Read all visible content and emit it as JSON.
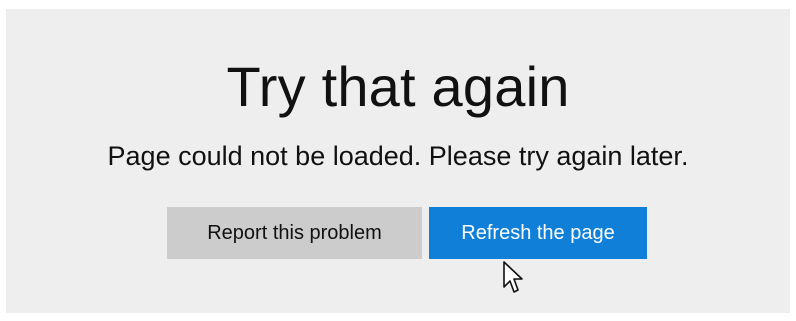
{
  "error_page": {
    "title": "Try that again",
    "message": "Page could not be loaded. Please try again later.",
    "buttons": {
      "report_label": "Report this problem",
      "refresh_label": "Refresh the page"
    }
  },
  "colors": {
    "panel_background": "#eeeeee",
    "secondary_button": "#cccccc",
    "primary_button": "#0f7fd8"
  },
  "icons": {
    "pointer": "mouse-pointer-icon"
  }
}
